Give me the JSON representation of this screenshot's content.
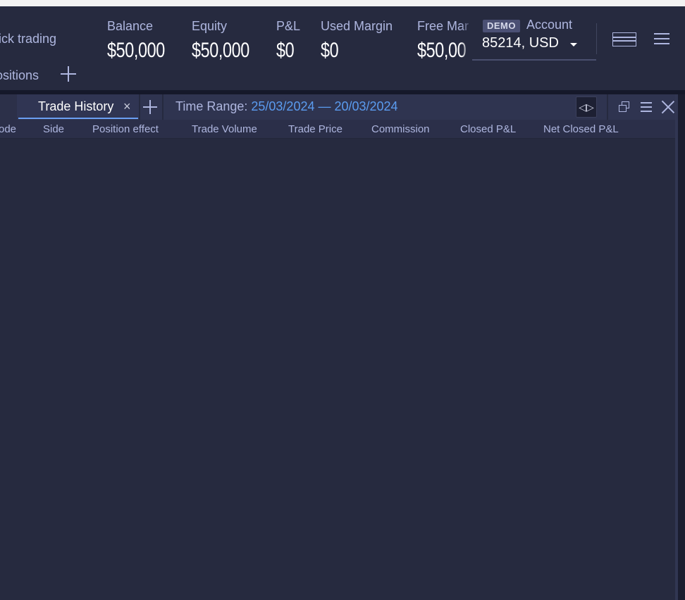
{
  "header": {
    "nav": {
      "one_click_trading": "lick trading",
      "positions": "ositions"
    },
    "stats": {
      "balance": {
        "label": "Balance",
        "value": "$50,000"
      },
      "equity": {
        "label": "Equity",
        "value": "$50,000"
      },
      "pl": {
        "label": "P&L",
        "value": "$0"
      },
      "used_margin": {
        "label": "Used Margin",
        "value": "$0"
      },
      "free_margin": {
        "label": "Free Mar",
        "value": "$50,00"
      }
    },
    "account": {
      "badge": "DEMO",
      "label": "Account",
      "value": "85214, USD"
    }
  },
  "panel": {
    "active_tab": {
      "label": "Trade History",
      "close": "×"
    },
    "time_range": {
      "label": "Time Range:",
      "value": "25/03/2024 — 20/03/2024"
    },
    "split_button": "◁▷",
    "columns": [
      "ode",
      "Side",
      "Position effect",
      "Trade Volume",
      "Trade Price",
      "Commission",
      "Closed P&L",
      "Net Closed P&L"
    ],
    "rows": []
  },
  "colors": {
    "background": "#262a3f",
    "text_muted": "#aeb6df",
    "accent": "#5b9cf0",
    "white": "#ffffff"
  }
}
